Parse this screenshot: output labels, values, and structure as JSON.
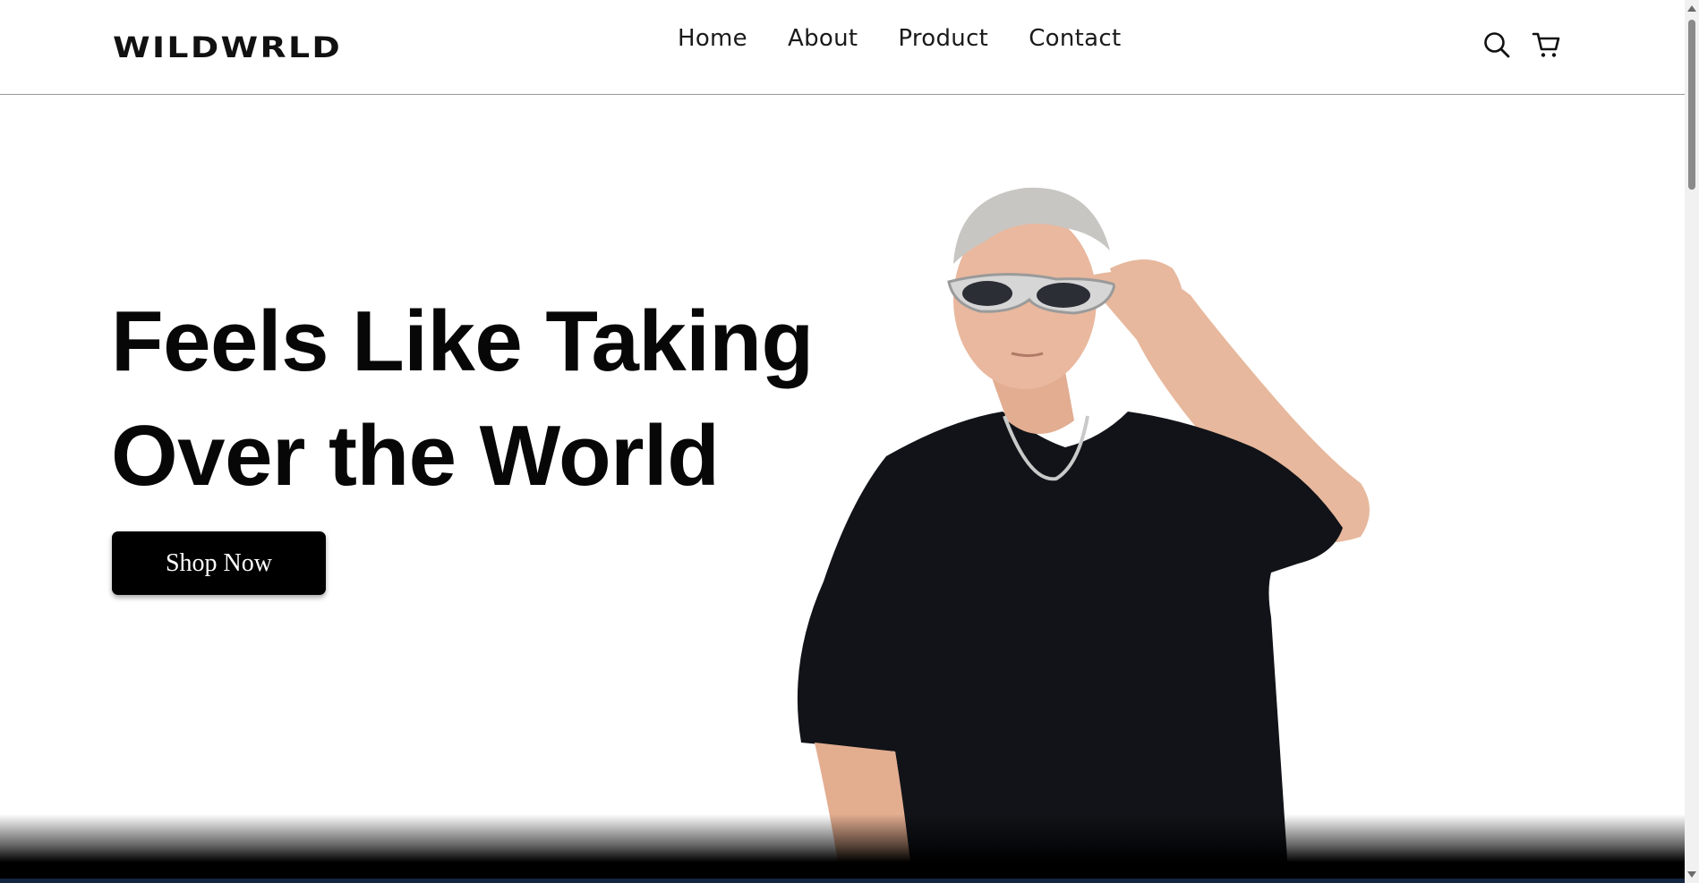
{
  "brand": {
    "name": "WILDWRLD"
  },
  "nav": {
    "items": [
      {
        "label": "Home"
      },
      {
        "label": "About"
      },
      {
        "label": "Product"
      },
      {
        "label": "Contact"
      }
    ]
  },
  "header_icons": {
    "search": "search-icon",
    "cart": "cart-icon"
  },
  "hero": {
    "title_line1": "Feels Like Taking",
    "title_line2": "Over the World",
    "cta_label": "Shop Now"
  },
  "colors": {
    "background": "#ffffff",
    "text": "#070707",
    "button": "#000000",
    "button_text": "#ffffff"
  }
}
